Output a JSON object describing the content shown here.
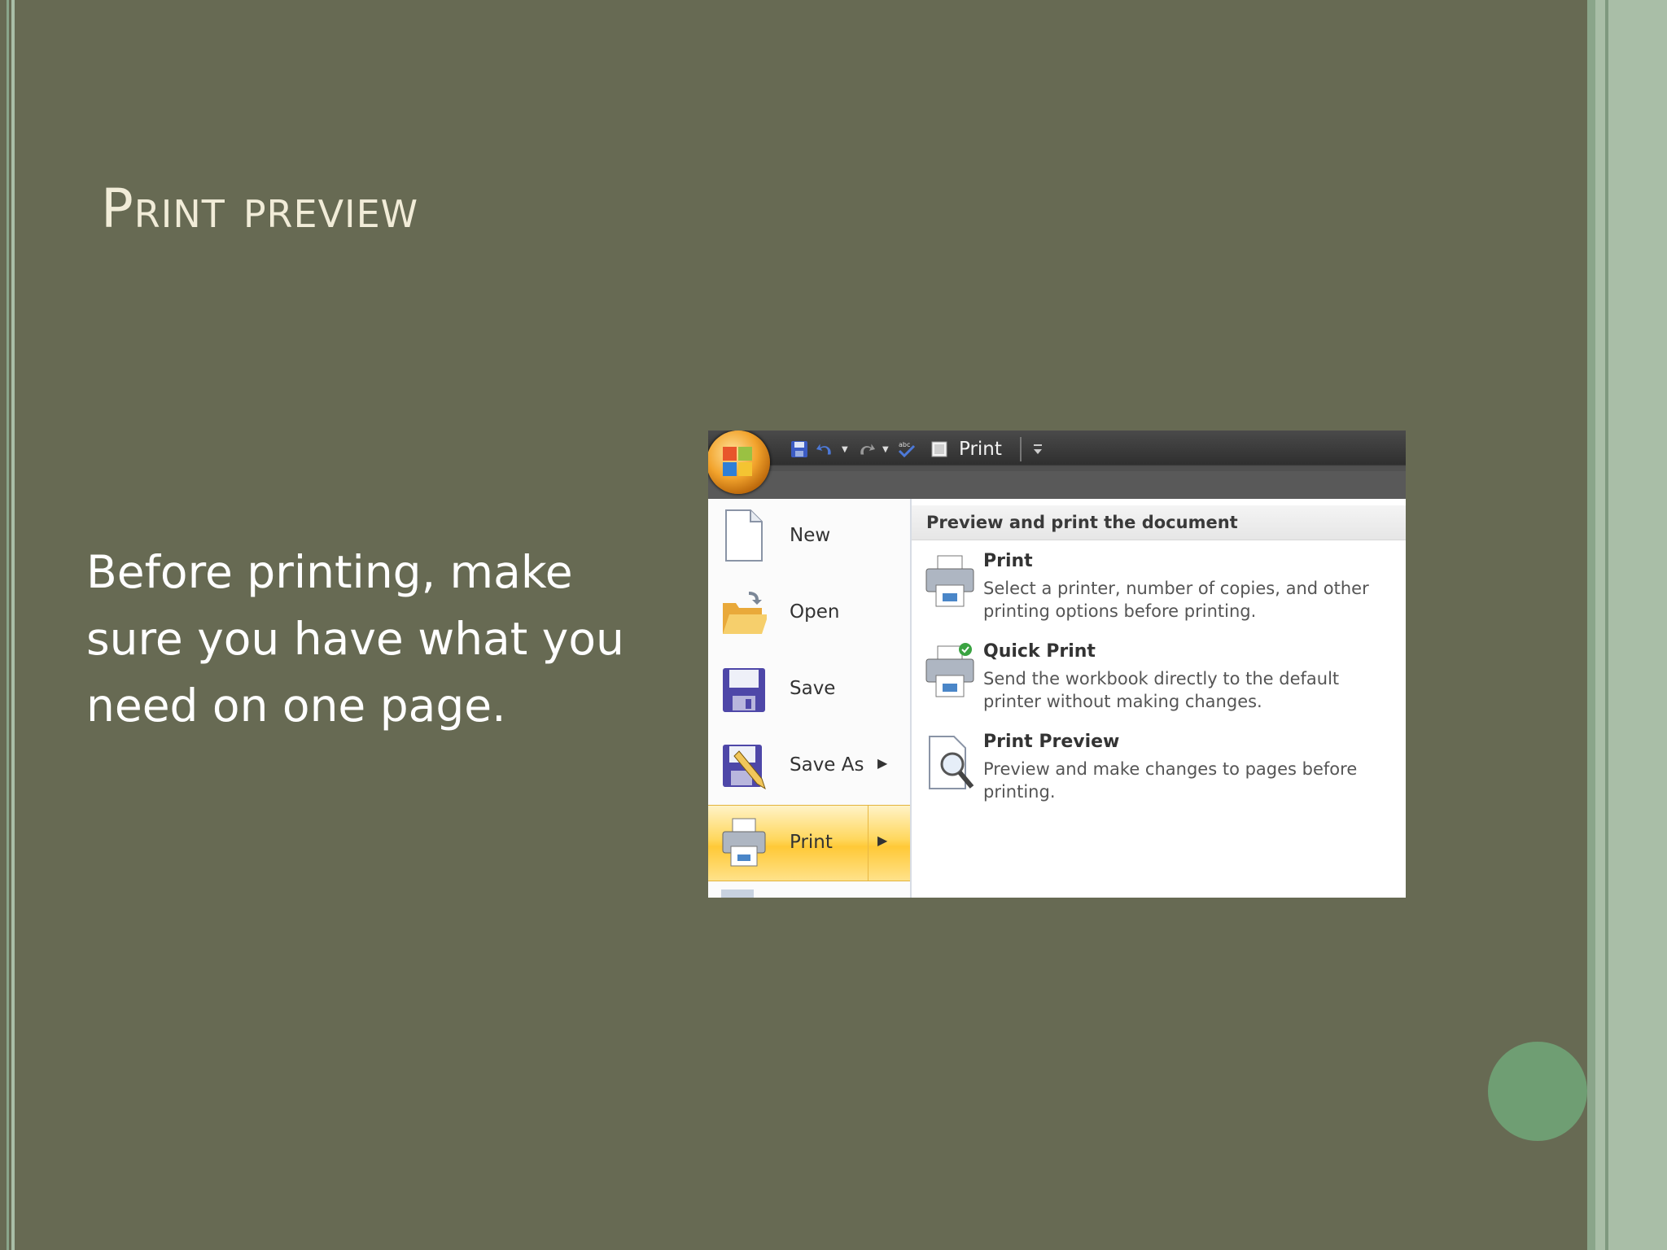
{
  "slide": {
    "title": "Print preview",
    "body": "Before printing, make sure you have what you need on one page."
  },
  "colors": {
    "background": "#676a53",
    "title": "#f1ecd8",
    "accent_dot": "#6f9e73",
    "right_border": "#a9bea7",
    "menu_highlight": "#ffd75d"
  },
  "quick_access_toolbar": {
    "icons": [
      "save-icon",
      "undo-icon",
      "redo-icon",
      "spelling-icon",
      "print-checkbox-icon",
      "customize-icon"
    ],
    "print_label": "Print"
  },
  "office_menu": {
    "items": [
      {
        "label": "New",
        "icon": "new-document-icon",
        "has_submenu": false
      },
      {
        "label": "Open",
        "icon": "open-folder-icon",
        "has_submenu": false
      },
      {
        "label": "Save",
        "icon": "save-disk-icon",
        "has_submenu": false
      },
      {
        "label": "Save As",
        "icon": "save-as-icon",
        "has_submenu": true
      },
      {
        "label": "Print",
        "icon": "printer-icon",
        "has_submenu": true,
        "active": true
      }
    ]
  },
  "submenu": {
    "header": "Preview and print the document",
    "options": [
      {
        "title": "Print",
        "description": "Select a printer, number of copies, and other printing options before printing.",
        "icon": "printer-icon"
      },
      {
        "title": "Quick Print",
        "description": "Send the workbook directly to the default printer without making changes.",
        "icon": "quick-print-icon"
      },
      {
        "title": "Print Preview",
        "description": "Preview and make changes to pages before printing.",
        "icon": "print-preview-icon"
      }
    ]
  }
}
